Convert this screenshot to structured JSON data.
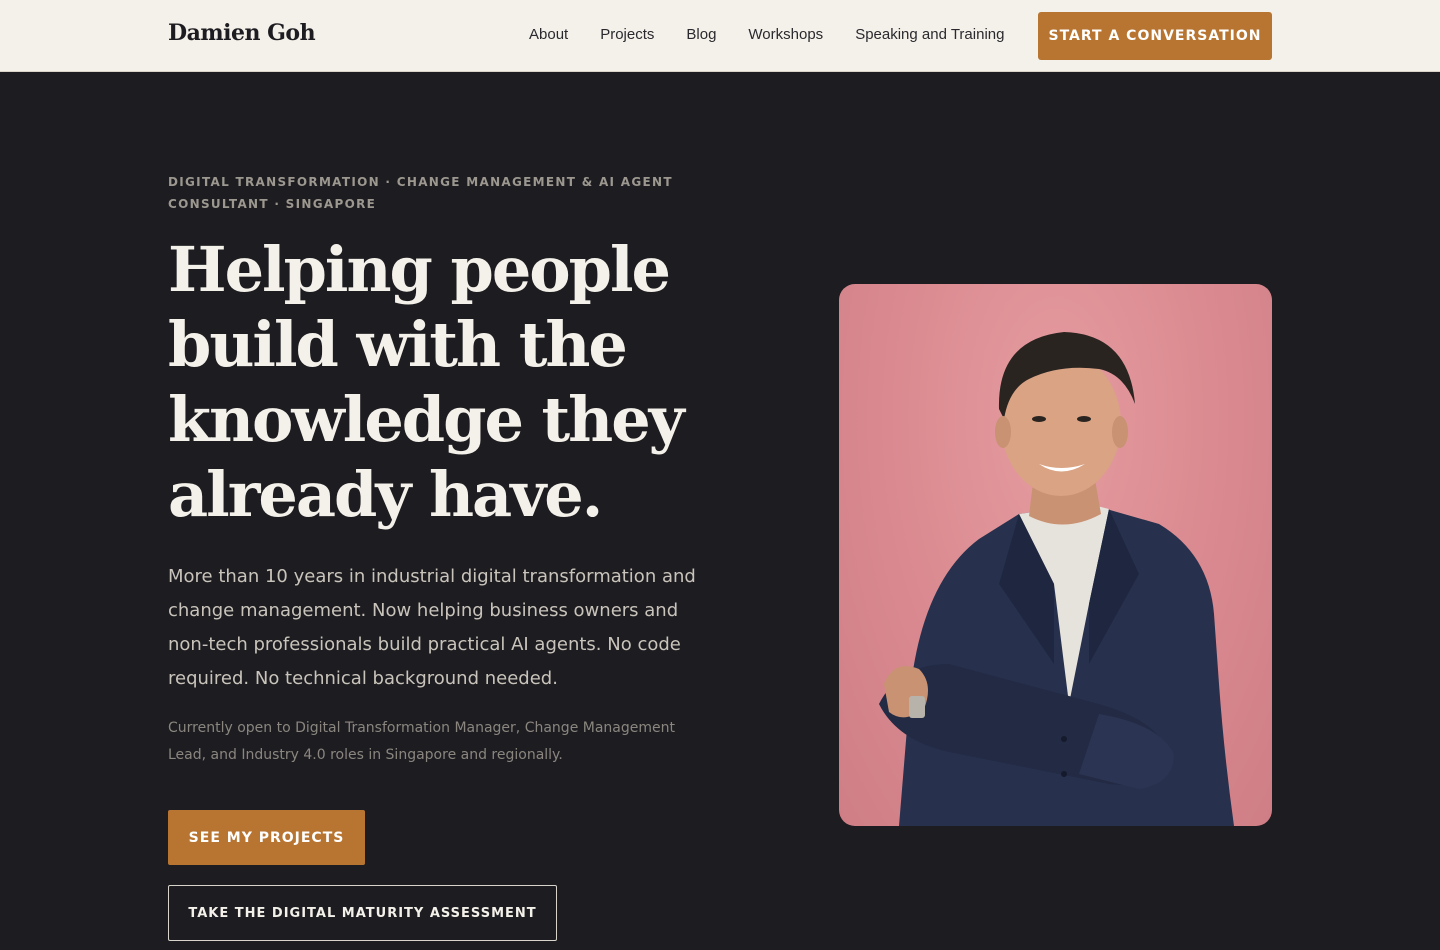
{
  "header": {
    "brand": "Damien Goh",
    "nav": [
      "About",
      "Projects",
      "Blog",
      "Workshops",
      "Speaking and Training"
    ],
    "cta": "START A CONVERSATION"
  },
  "hero": {
    "eyebrow": "DIGITAL TRANSFORMATION · CHANGE MANAGEMENT & AI AGENT CONSULTANT · SINGAPORE",
    "headline": "Helping people build with the knowledge they already have.",
    "intro": "More than 10 years in industrial digital transformation and change management. Now helping business owners and non-tech professionals build practical AI agents. No code required. No technical background needed.",
    "note": "Currently open to Digital Transformation Manager, Change Management Lead, and Industry 4.0 roles in Singapore and regionally.",
    "primary_button": "SEE MY PROJECTS",
    "secondary_button": "TAKE THE DIGITAL MATURITY ASSESSMENT"
  },
  "colors": {
    "accent": "#b87532",
    "dark_bg": "#1d1c20",
    "light_bg": "#f4f0ea"
  }
}
